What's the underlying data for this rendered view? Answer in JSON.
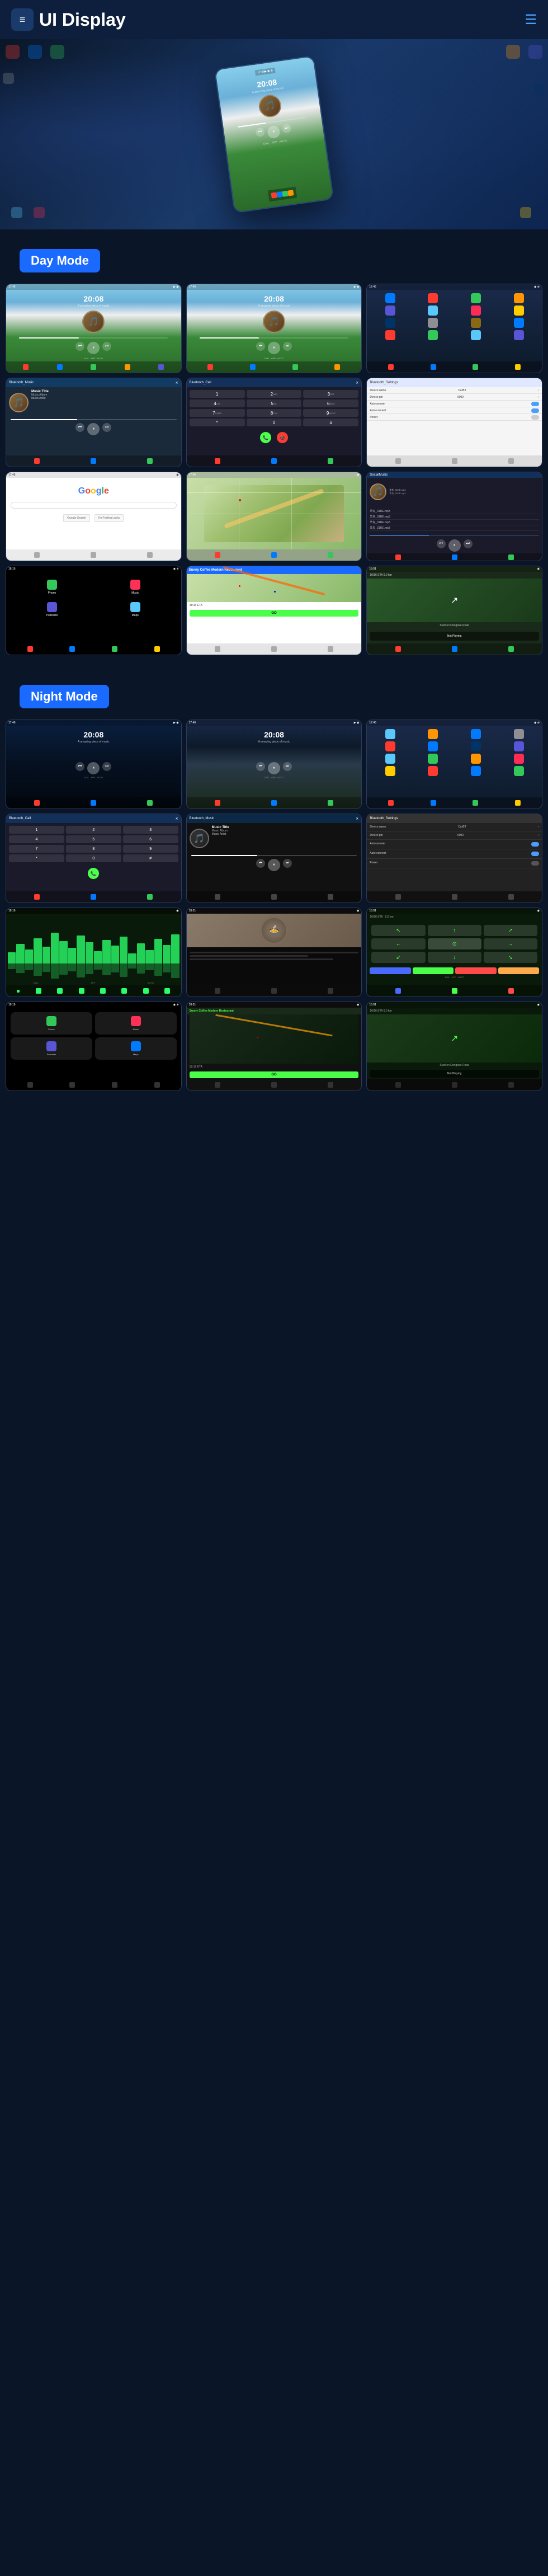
{
  "header": {
    "title": "UI Display",
    "logo_icon": "≡",
    "menu_icon": "☰"
  },
  "day_mode": {
    "label": "Day Mode"
  },
  "night_mode": {
    "label": "Night Mode"
  },
  "music": {
    "title": "Music Title",
    "album": "Music Album",
    "artist": "Music Artist",
    "time": "20:08",
    "time_subtitle": "A amazing piece of music"
  },
  "bluetooth_music": "Bluetooth_Music",
  "bluetooth_call": "Bluetooth_Call",
  "bluetooth_settings": "Bluetooth_Settings",
  "sunny_coffee": "Sunny Coffee Modern Restaurant",
  "eta": "18:16 ETA",
  "go_label": "GO",
  "device": {
    "name_label": "Device name",
    "name_value": "CarBT",
    "pin_label": "Device pin",
    "pin_value": "0000",
    "auto_answer": "Auto answer",
    "auto_connect": "Auto connect",
    "power": "Power"
  },
  "google_text": "Google",
  "social_music": "SocialMusic",
  "not_playing": "Not Playing",
  "navigation": {
    "distance": "10/16 ETA  9.0 km",
    "instruction": "Start on Dongbae Road"
  },
  "colors": {
    "accent_blue": "#1a6aff",
    "day_mode_bg": "#0d1f3c",
    "night_mode_bg": "#050d1a"
  },
  "screens": {
    "day": {
      "row1": [
        "home_time1",
        "home_time2",
        "apps_grid"
      ],
      "row2": [
        "bt_music",
        "bt_call",
        "bt_settings"
      ],
      "row3": [
        "google",
        "map",
        "social_music"
      ],
      "row4": [
        "carplay",
        "nav_route",
        "nav_music"
      ]
    },
    "night": {
      "row1": [
        "home_dark1",
        "home_dark2",
        "apps_dark"
      ],
      "row2": [
        "bt_call_dark",
        "bt_music_dark",
        "bt_settings_dark"
      ],
      "row3": [
        "wave_vis",
        "food_img",
        "nav_arrows"
      ],
      "row4": [
        "carplay_dark",
        "nav_dark",
        "nav_music_dark"
      ]
    }
  }
}
